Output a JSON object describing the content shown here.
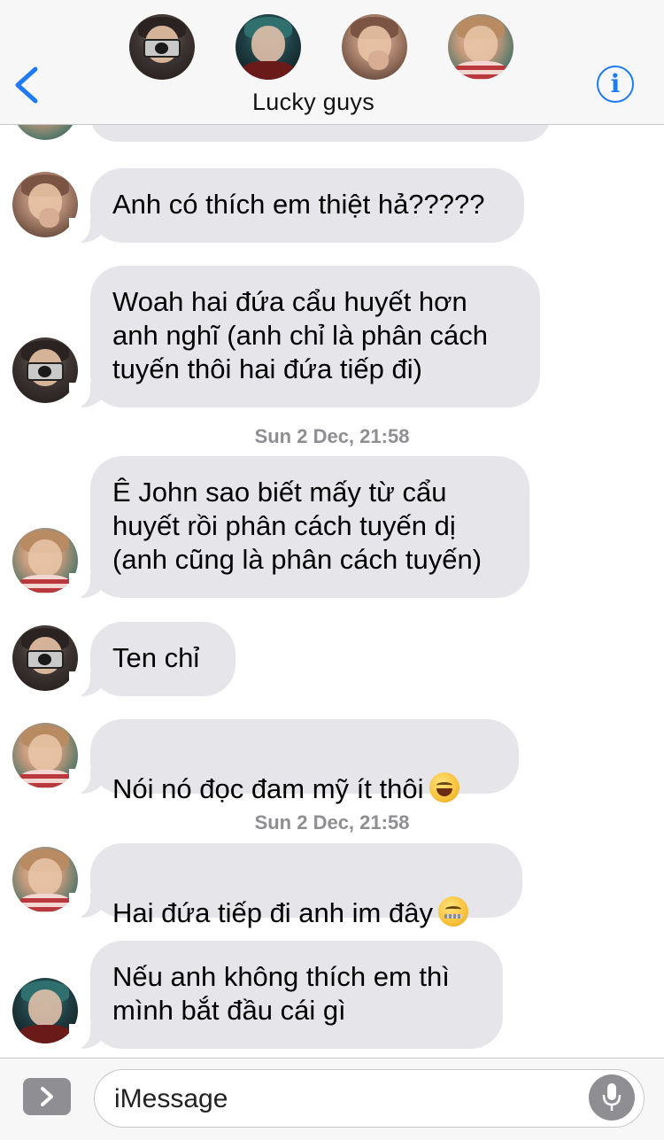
{
  "header": {
    "title": "Lucky guys",
    "participants": [
      {
        "id": "john-avatar"
      },
      {
        "id": "jaehyun-avatar"
      },
      {
        "id": "ten-avatar"
      },
      {
        "id": "yuta-avatar"
      }
    ],
    "back_icon": "chevron-left-icon",
    "info_icon": "info-icon",
    "info_label": "i"
  },
  "conversation": {
    "messages": [
      {
        "sender": "ten",
        "text": "Anh có thích em thiệt hả?????"
      },
      {
        "sender": "john",
        "text": "Woah hai đứa cẩu huyết hơn\nanh nghĩ (anh chỉ là phân cách\ntuyến thôi hai đứa tiếp đi)"
      },
      {
        "sender": "yuta",
        "text": "Ê John sao biết mấy từ cẩu\nhuyết rồi phân cách tuyến dị\n(anh cũng là phân cách tuyến)"
      },
      {
        "sender": "john",
        "text": "Ten chỉ"
      },
      {
        "sender": "yuta",
        "text": "Nói nó đọc đam mỹ ít thôi",
        "emoji": "rolling-on-floor-laughing"
      },
      {
        "sender": "yuta",
        "text": "Hai đứa tiếp đi anh im đây",
        "emoji": "zipper-mouth-face"
      },
      {
        "sender": "jaehyun",
        "text": "Nếu anh không thích em thì\nmình bắt đầu cái gì"
      }
    ],
    "timestamps": [
      "Sun 2 Dec, 21:58",
      "Sun 2 Dec, 21:58"
    ]
  },
  "input_bar": {
    "placeholder": "iMessage",
    "apps_icon": "chevron-right-icon",
    "mic_icon": "microphone-icon"
  },
  "colors": {
    "accent": "#1d7bf5",
    "bubble_incoming": "#e5e5ea",
    "header_bg": "#f7f7f7",
    "timestamp": "#8e8e93"
  }
}
